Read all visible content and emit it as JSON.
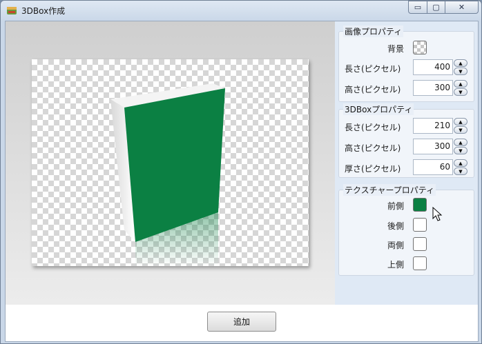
{
  "window": {
    "title": "3DBox作成"
  },
  "title_controls": {
    "minimize": "▭",
    "maximize": "▢",
    "close": "✕"
  },
  "image_props": {
    "title": "画像プロパティ",
    "background_label": "背景",
    "length_label": "長さ(ピクセル)",
    "length_value": "400",
    "height_label": "高さ(ピクセル)",
    "height_value": "300"
  },
  "box_props": {
    "title": "3DBoxプロパティ",
    "length_label": "長さ(ピクセル)",
    "length_value": "210",
    "height_label": "高さ(ピクセル)",
    "height_value": "300",
    "thickness_label": "厚さ(ピクセル)",
    "thickness_value": "60"
  },
  "texture_props": {
    "title": "テクスチャープロパティ",
    "front_label": "前側",
    "back_label": "後側",
    "sides_label": "両側",
    "top_label": "上側",
    "front_color": "#0b8043"
  },
  "footer": {
    "add_label": "追加"
  },
  "icons": {
    "spin_up": "▲",
    "spin_down": "▼"
  }
}
